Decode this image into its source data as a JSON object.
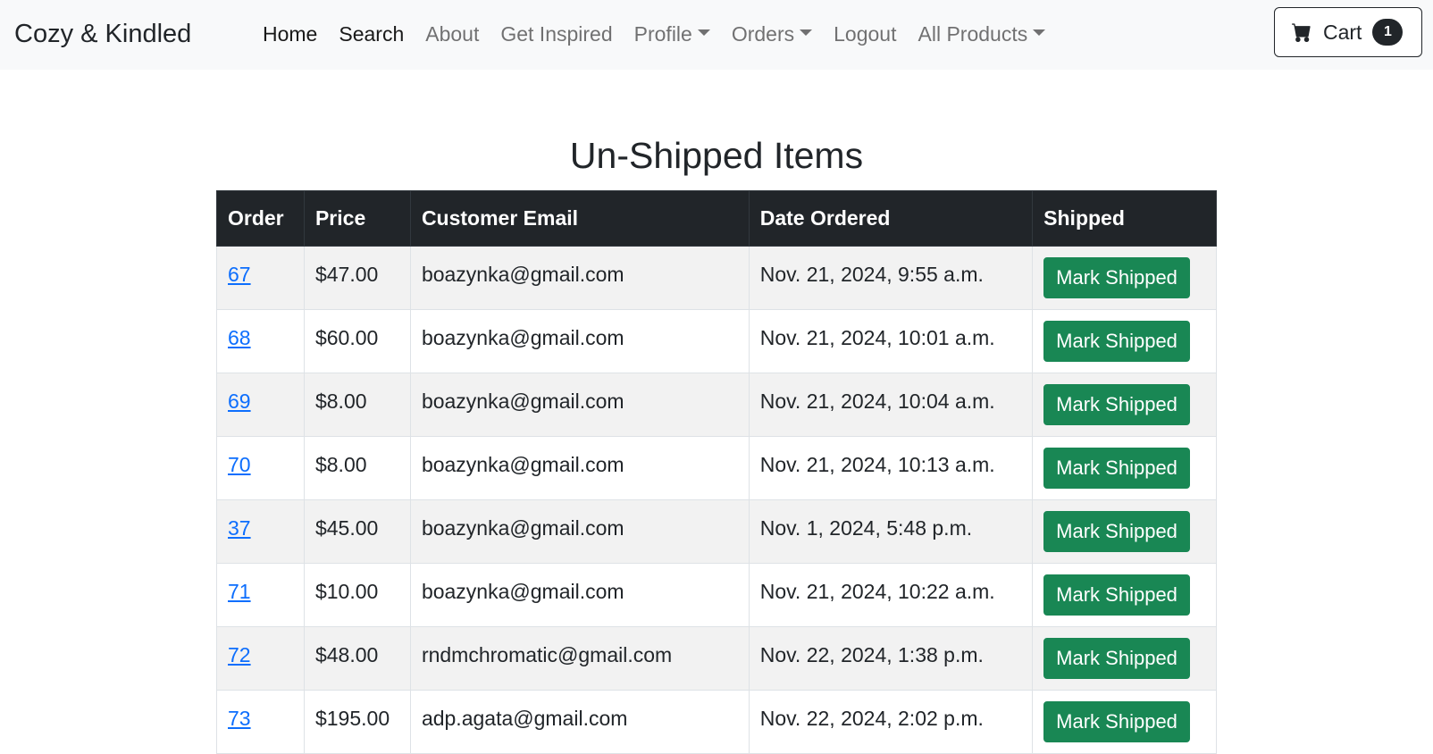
{
  "navbar": {
    "brand": "Cozy & Kindled",
    "links": [
      {
        "label": "Home",
        "active": true,
        "dropdown": false
      },
      {
        "label": "Search",
        "active": true,
        "dropdown": false
      },
      {
        "label": "About",
        "active": false,
        "dropdown": false
      },
      {
        "label": "Get Inspired",
        "active": false,
        "dropdown": false
      },
      {
        "label": "Profile",
        "active": false,
        "dropdown": true
      },
      {
        "label": "Orders",
        "active": false,
        "dropdown": true
      },
      {
        "label": "Logout",
        "active": false,
        "dropdown": false
      },
      {
        "label": "All Products",
        "active": false,
        "dropdown": true
      }
    ],
    "cart": {
      "label": "Cart",
      "count": "1",
      "icon": "cart-icon"
    }
  },
  "page": {
    "title": "Un-Shipped Items"
  },
  "table": {
    "headers": {
      "order": "Order",
      "price": "Price",
      "email": "Customer Email",
      "date": "Date Ordered",
      "shipped": "Shipped"
    },
    "button_label": "Mark Shipped",
    "rows": [
      {
        "order": "67",
        "price": "$47.00",
        "email": "boazynka@gmail.com",
        "date": "Nov. 21, 2024, 9:55 a.m."
      },
      {
        "order": "68",
        "price": "$60.00",
        "email": "boazynka@gmail.com",
        "date": "Nov. 21, 2024, 10:01 a.m."
      },
      {
        "order": "69",
        "price": "$8.00",
        "email": "boazynka@gmail.com",
        "date": "Nov. 21, 2024, 10:04 a.m."
      },
      {
        "order": "70",
        "price": "$8.00",
        "email": "boazynka@gmail.com",
        "date": "Nov. 21, 2024, 10:13 a.m."
      },
      {
        "order": "37",
        "price": "$45.00",
        "email": "boazynka@gmail.com",
        "date": "Nov. 1, 2024, 5:48 p.m."
      },
      {
        "order": "71",
        "price": "$10.00",
        "email": "boazynka@gmail.com",
        "date": "Nov. 21, 2024, 10:22 a.m."
      },
      {
        "order": "72",
        "price": "$48.00",
        "email": "rndmchromatic@gmail.com",
        "date": "Nov. 22, 2024, 1:38 p.m."
      },
      {
        "order": "73",
        "price": "$195.00",
        "email": "adp.agata@gmail.com",
        "date": "Nov. 22, 2024, 2:02 p.m."
      }
    ]
  },
  "colors": {
    "navbar_bg": "#f8f9fa",
    "header_bg": "#212529",
    "button_green": "#198754",
    "link_blue": "#0d6efd",
    "stripe": "#f2f2f2"
  }
}
